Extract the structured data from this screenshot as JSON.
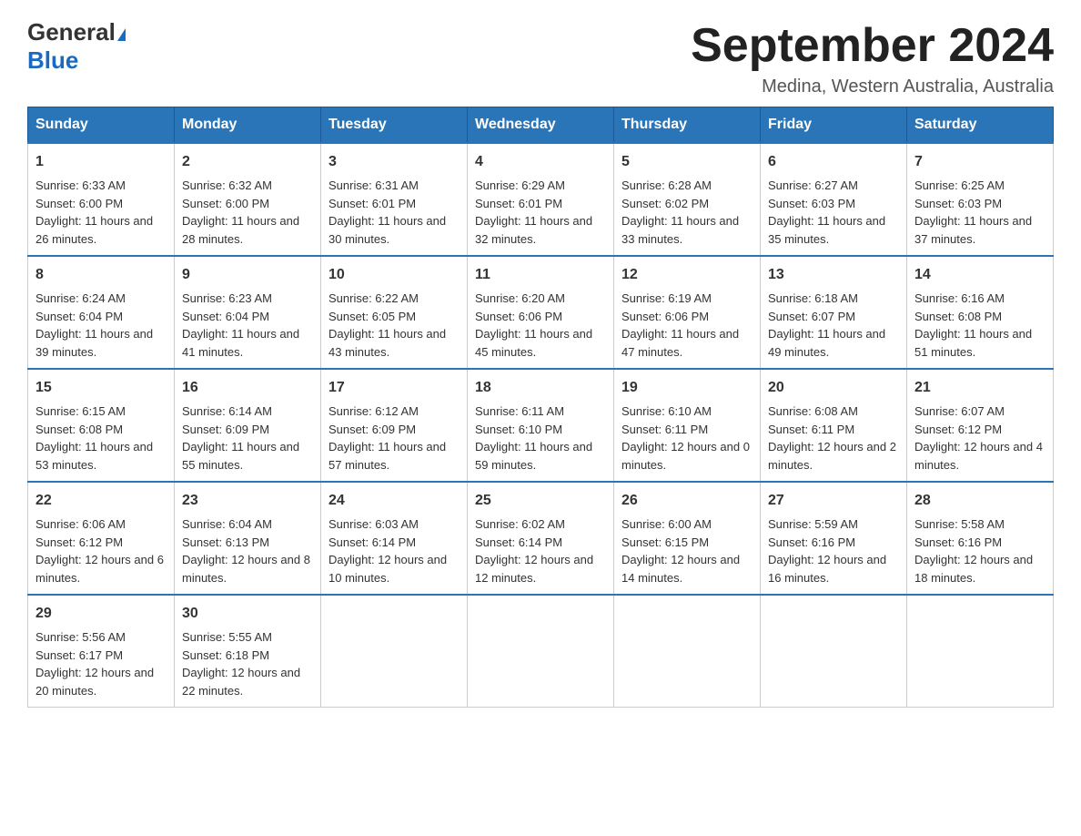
{
  "header": {
    "logo_general": "General",
    "logo_blue": "Blue",
    "month_title": "September 2024",
    "subtitle": "Medina, Western Australia, Australia"
  },
  "days_of_week": [
    "Sunday",
    "Monday",
    "Tuesday",
    "Wednesday",
    "Thursday",
    "Friday",
    "Saturday"
  ],
  "weeks": [
    [
      {
        "num": "1",
        "sunrise": "6:33 AM",
        "sunset": "6:00 PM",
        "daylight": "11 hours and 26 minutes."
      },
      {
        "num": "2",
        "sunrise": "6:32 AM",
        "sunset": "6:00 PM",
        "daylight": "11 hours and 28 minutes."
      },
      {
        "num": "3",
        "sunrise": "6:31 AM",
        "sunset": "6:01 PM",
        "daylight": "11 hours and 30 minutes."
      },
      {
        "num": "4",
        "sunrise": "6:29 AM",
        "sunset": "6:01 PM",
        "daylight": "11 hours and 32 minutes."
      },
      {
        "num": "5",
        "sunrise": "6:28 AM",
        "sunset": "6:02 PM",
        "daylight": "11 hours and 33 minutes."
      },
      {
        "num": "6",
        "sunrise": "6:27 AM",
        "sunset": "6:03 PM",
        "daylight": "11 hours and 35 minutes."
      },
      {
        "num": "7",
        "sunrise": "6:25 AM",
        "sunset": "6:03 PM",
        "daylight": "11 hours and 37 minutes."
      }
    ],
    [
      {
        "num": "8",
        "sunrise": "6:24 AM",
        "sunset": "6:04 PM",
        "daylight": "11 hours and 39 minutes."
      },
      {
        "num": "9",
        "sunrise": "6:23 AM",
        "sunset": "6:04 PM",
        "daylight": "11 hours and 41 minutes."
      },
      {
        "num": "10",
        "sunrise": "6:22 AM",
        "sunset": "6:05 PM",
        "daylight": "11 hours and 43 minutes."
      },
      {
        "num": "11",
        "sunrise": "6:20 AM",
        "sunset": "6:06 PM",
        "daylight": "11 hours and 45 minutes."
      },
      {
        "num": "12",
        "sunrise": "6:19 AM",
        "sunset": "6:06 PM",
        "daylight": "11 hours and 47 minutes."
      },
      {
        "num": "13",
        "sunrise": "6:18 AM",
        "sunset": "6:07 PM",
        "daylight": "11 hours and 49 minutes."
      },
      {
        "num": "14",
        "sunrise": "6:16 AM",
        "sunset": "6:08 PM",
        "daylight": "11 hours and 51 minutes."
      }
    ],
    [
      {
        "num": "15",
        "sunrise": "6:15 AM",
        "sunset": "6:08 PM",
        "daylight": "11 hours and 53 minutes."
      },
      {
        "num": "16",
        "sunrise": "6:14 AM",
        "sunset": "6:09 PM",
        "daylight": "11 hours and 55 minutes."
      },
      {
        "num": "17",
        "sunrise": "6:12 AM",
        "sunset": "6:09 PM",
        "daylight": "11 hours and 57 minutes."
      },
      {
        "num": "18",
        "sunrise": "6:11 AM",
        "sunset": "6:10 PM",
        "daylight": "11 hours and 59 minutes."
      },
      {
        "num": "19",
        "sunrise": "6:10 AM",
        "sunset": "6:11 PM",
        "daylight": "12 hours and 0 minutes."
      },
      {
        "num": "20",
        "sunrise": "6:08 AM",
        "sunset": "6:11 PM",
        "daylight": "12 hours and 2 minutes."
      },
      {
        "num": "21",
        "sunrise": "6:07 AM",
        "sunset": "6:12 PM",
        "daylight": "12 hours and 4 minutes."
      }
    ],
    [
      {
        "num": "22",
        "sunrise": "6:06 AM",
        "sunset": "6:12 PM",
        "daylight": "12 hours and 6 minutes."
      },
      {
        "num": "23",
        "sunrise": "6:04 AM",
        "sunset": "6:13 PM",
        "daylight": "12 hours and 8 minutes."
      },
      {
        "num": "24",
        "sunrise": "6:03 AM",
        "sunset": "6:14 PM",
        "daylight": "12 hours and 10 minutes."
      },
      {
        "num": "25",
        "sunrise": "6:02 AM",
        "sunset": "6:14 PM",
        "daylight": "12 hours and 12 minutes."
      },
      {
        "num": "26",
        "sunrise": "6:00 AM",
        "sunset": "6:15 PM",
        "daylight": "12 hours and 14 minutes."
      },
      {
        "num": "27",
        "sunrise": "5:59 AM",
        "sunset": "6:16 PM",
        "daylight": "12 hours and 16 minutes."
      },
      {
        "num": "28",
        "sunrise": "5:58 AM",
        "sunset": "6:16 PM",
        "daylight": "12 hours and 18 minutes."
      }
    ],
    [
      {
        "num": "29",
        "sunrise": "5:56 AM",
        "sunset": "6:17 PM",
        "daylight": "12 hours and 20 minutes."
      },
      {
        "num": "30",
        "sunrise": "5:55 AM",
        "sunset": "6:18 PM",
        "daylight": "12 hours and 22 minutes."
      },
      null,
      null,
      null,
      null,
      null
    ]
  ]
}
